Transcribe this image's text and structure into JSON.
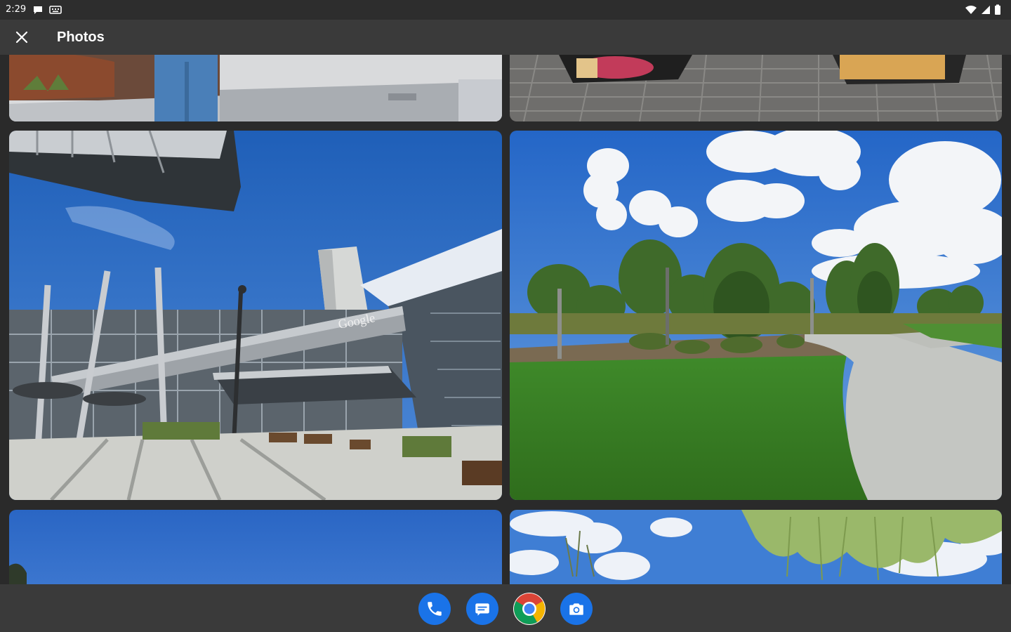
{
  "status_bar": {
    "time": "2:29",
    "left_icons": [
      "chat-bubble-icon",
      "keyboard-icon"
    ],
    "right_icons": [
      "wifi-icon",
      "signal-icon",
      "battery-icon"
    ]
  },
  "app_bar": {
    "close_icon": "close-icon",
    "title": "Photos"
  },
  "photos": [
    {
      "name": "photo-person-jeans",
      "description_visible": false
    },
    {
      "name": "photo-brick-sidewalk",
      "description_visible": false
    },
    {
      "name": "photo-google-building",
      "sign_text": "Google"
    },
    {
      "name": "photo-park-lawn-path",
      "description_visible": false
    },
    {
      "name": "photo-blue-sky",
      "description_visible": false
    },
    {
      "name": "photo-sky-willow",
      "description_visible": false
    }
  ],
  "dock": {
    "apps": [
      {
        "name": "phone-icon",
        "color": "#1a73e8"
      },
      {
        "name": "messages-icon",
        "color": "#1a73e8"
      },
      {
        "name": "chrome-icon",
        "color": "#ffffff"
      },
      {
        "name": "camera-icon",
        "color": "#1a73e8"
      }
    ]
  }
}
